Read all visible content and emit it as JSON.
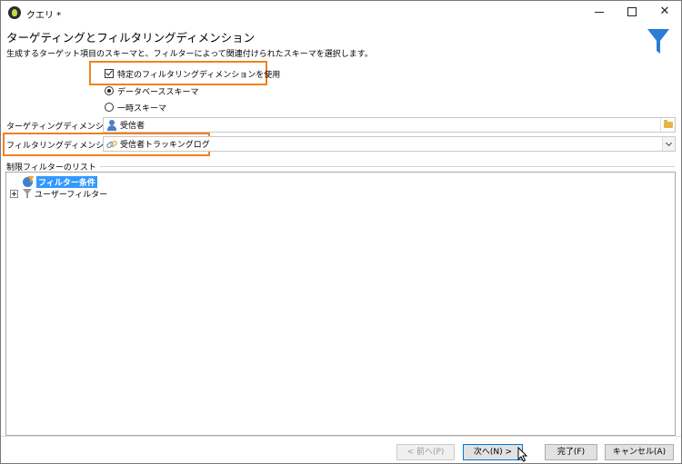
{
  "window": {
    "title": "クエリ *"
  },
  "header": {
    "title": "ターゲティングとフィルタリングディメンション",
    "description": "生成するターゲット項目のスキーマと、フィルターによって関連付けられたスキーマを選択します。"
  },
  "options": {
    "use_filtering_dimension_label": "特定のフィルタリングディメンションを使用",
    "use_filtering_dimension_checked": true,
    "radio_database_schema_label": "データベーススキーマ",
    "radio_temporary_schema_label": "一時スキーマ",
    "selected_radio": "データベーススキーマ"
  },
  "fields": {
    "targeting_label": "ターゲティングディメンション:",
    "targeting_value": "受信者",
    "filtering_label": "フィルタリングディメンション:",
    "filtering_value": "受信者トラッキングログ"
  },
  "restriction": {
    "section_label": "制限フィルターのリスト",
    "tree": [
      {
        "label": "フィルター条件",
        "selected": true,
        "icon": "filter-conditions-icon"
      },
      {
        "label": "ユーザーフィルター",
        "selected": false,
        "icon": "funnel-icon",
        "expandable": true
      }
    ]
  },
  "footer": {
    "prev_label": "< 前へ(P)",
    "next_label": "次へ(N) >",
    "finish_label": "完了(F)",
    "cancel_label": "キャンセル(A)"
  },
  "colors": {
    "highlight": "#f0821e",
    "accent_blue": "#0078d7",
    "funnel_blue": "#2a7cd5",
    "selection": "#3399ff"
  }
}
